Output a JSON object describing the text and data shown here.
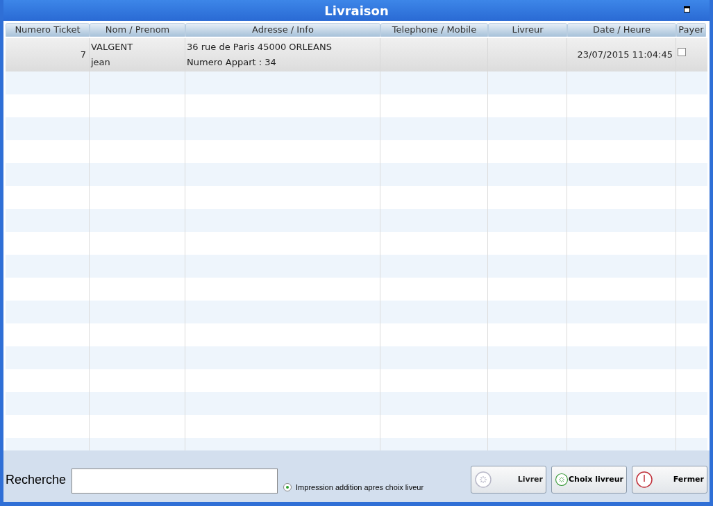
{
  "window": {
    "title": "Livraison"
  },
  "table": {
    "columns": [
      "Numero Ticket",
      "Nom / Prenom",
      "Adresse / Info",
      "Telephone / Mobile",
      "Livreur",
      "Date / Heure",
      "Payer"
    ],
    "rows": [
      {
        "ticket": "7",
        "name": [
          "VALGENT",
          "jean"
        ],
        "address": [
          "36 rue de Paris 45000 ORLEANS",
          "Numero Appart : 34"
        ],
        "date": "23/07/2015 11:04:45",
        "paid": false,
        "selected": true
      }
    ]
  },
  "search": {
    "label": "Recherche"
  },
  "option": {
    "label": "Impression addition apres choix liveur",
    "checked": true
  },
  "buttons": [
    {
      "label": "Livrer",
      "kind": "spinner",
      "disabled": true
    },
    {
      "label": "Choix livreur",
      "kind": "spinner",
      "disabled": false
    },
    {
      "label": "Fermer",
      "kind": "power",
      "disabled": false
    }
  ]
}
